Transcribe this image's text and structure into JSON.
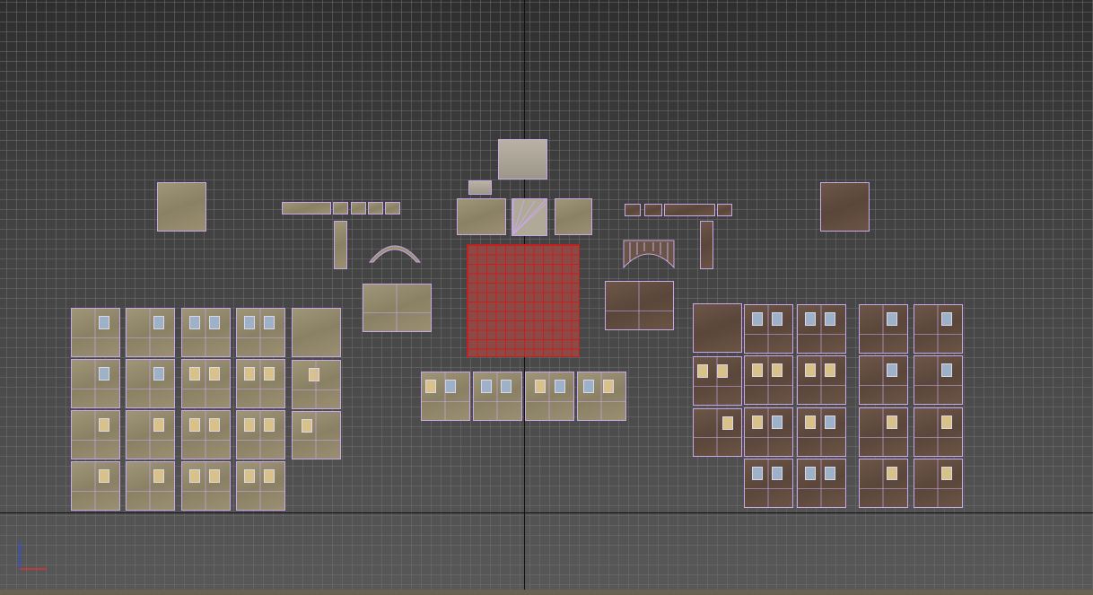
{
  "viewport": {
    "name": "uv-editor-viewport",
    "background_color": "#474747",
    "grid_color": "#6e6e6e",
    "axis_color": "#111111",
    "uv_edge_color": "#c8a8e8",
    "selected_edge_color": "#c02020"
  },
  "gizmo": {
    "z_label": "z",
    "z_color": "#3050e0",
    "x_color": "#e03030"
  },
  "materials": {
    "beige": "#9a8f71",
    "brown": "#5f4a3d",
    "window_glass": "#9db2c8",
    "window_lit": "#d8c28a"
  }
}
